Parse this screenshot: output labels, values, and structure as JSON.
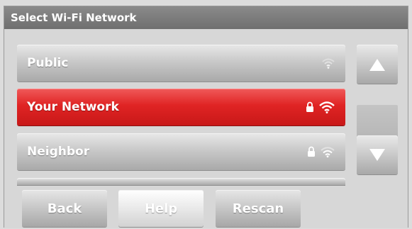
{
  "header": {
    "title": "Select Wi-Fi Network"
  },
  "networks": [
    {
      "name": "Public",
      "locked": false,
      "signal_icon": "wifi-weak-icon",
      "selected": false
    },
    {
      "name": "Your Network",
      "locked": true,
      "signal_icon": "wifi-strong-icon",
      "selected": true
    },
    {
      "name": "Neighbor",
      "locked": true,
      "signal_icon": "wifi-medium-icon",
      "selected": false
    }
  ],
  "scroll": {
    "up_icon": "triangle-up-icon",
    "down_icon": "triangle-down-icon"
  },
  "buttons": {
    "back": "Back",
    "help": "Help",
    "rescan": "Rescan"
  },
  "colors": {
    "selected": "#e02424",
    "titlebar": "#7a7a7a",
    "button_text": "#ffffff"
  }
}
